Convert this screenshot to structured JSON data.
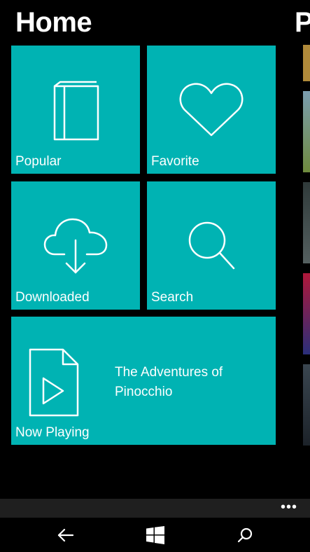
{
  "header": {
    "title": "Home",
    "next_pivot_peek": "P"
  },
  "tiles": {
    "popular": {
      "label": "Popular",
      "icon": "book-icon"
    },
    "favorite": {
      "label": "Favorite",
      "icon": "heart-icon"
    },
    "downloaded": {
      "label": "Downloaded",
      "icon": "cloud-download-icon"
    },
    "search": {
      "label": "Search",
      "icon": "search-icon"
    },
    "now_playing": {
      "label": "Now Playing",
      "icon": "media-file-play-icon",
      "book_title": "The Adventures of Pinocchio"
    }
  },
  "app_bar": {
    "more_label": "•••"
  },
  "nav_bar": {
    "back": "back-arrow-icon",
    "start": "windows-logo-icon",
    "search": "search-icon"
  },
  "colors": {
    "tile": "#00b3b3",
    "background": "#000000",
    "app_bar": "#1f1f1f"
  }
}
